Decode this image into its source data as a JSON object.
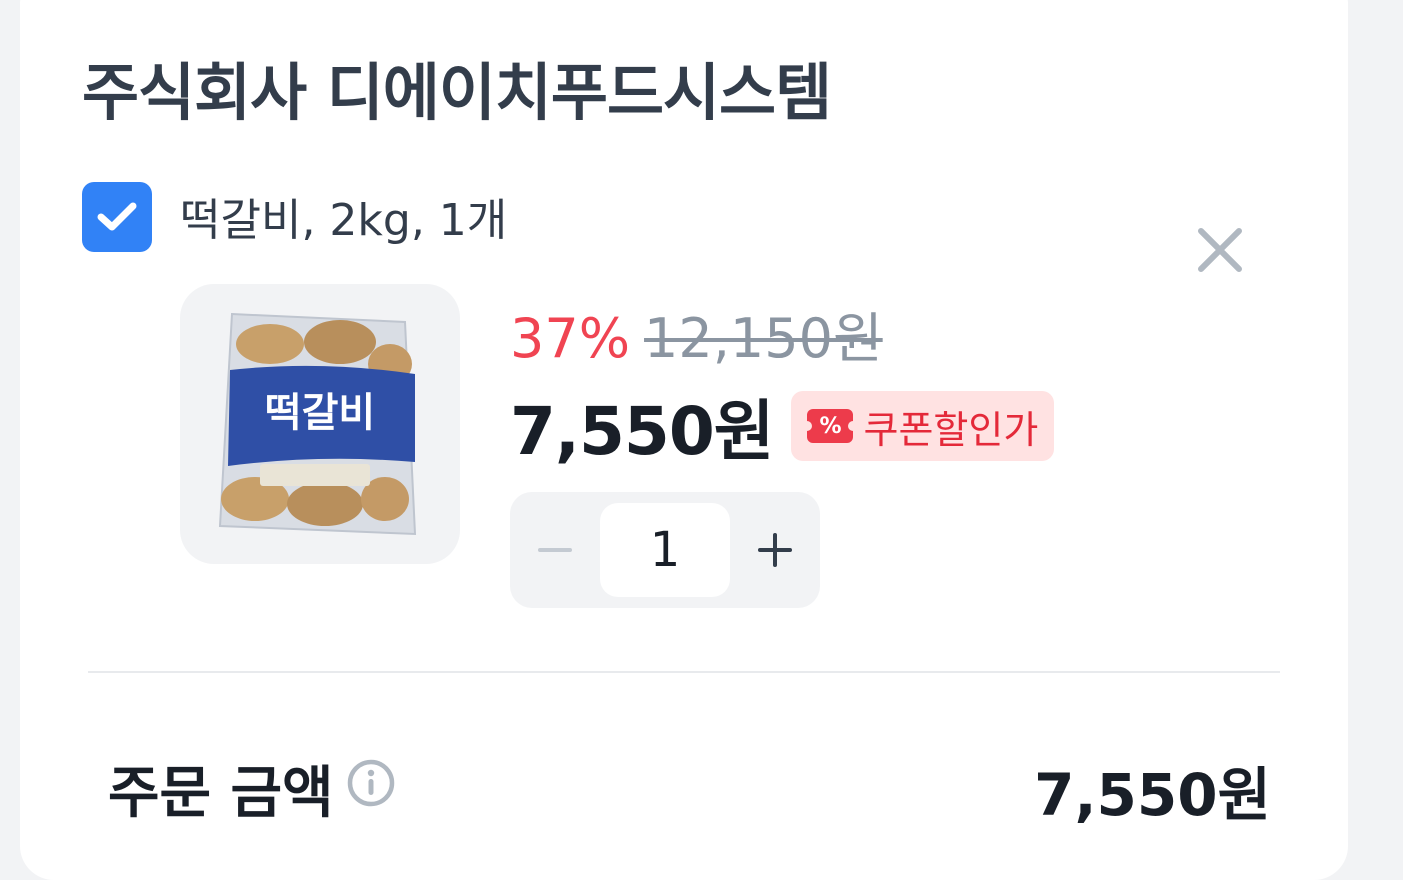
{
  "seller": {
    "name": "주식회사 디에이치푸드시스템"
  },
  "item": {
    "checked": true,
    "option_text": "떡갈비, 2kg, 1개",
    "image_alt": "떡갈비 2kg 상품 이미지",
    "image_text": "떡갈비",
    "discount_rate": "37%",
    "original_price": "12,150원",
    "sale_price": "7,550원",
    "coupon_label": "쿠폰할인가",
    "quantity": "1"
  },
  "summary": {
    "order_label": "주문 금액",
    "order_total": "7,550원"
  },
  "colors": {
    "accent": "#3182f6",
    "discount": "#f04452",
    "coupon_bg": "#ffe2e2",
    "coupon_text": "#e42939"
  },
  "icons": {
    "checkbox": "check-icon",
    "remove": "close-icon",
    "minus": "minus-icon",
    "plus": "plus-icon",
    "info": "info-icon",
    "coupon": "percent-ticket-icon"
  }
}
